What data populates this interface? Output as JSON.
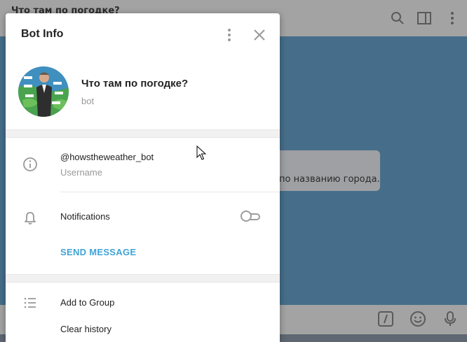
{
  "background": {
    "chat_title": "Что там по погодке?",
    "message_text": "по названию города.",
    "icons": [
      "search-icon",
      "sidebar-toggle-icon",
      "menu-icon",
      "bot-command-icon",
      "emoji-icon",
      "microphone-icon"
    ]
  },
  "modal": {
    "title": "Bot Info",
    "bot_name": "Что там по погодке?",
    "bot_status": "bot",
    "username": "@howstheweather_bot",
    "username_label": "Username",
    "notifications_label": "Notifications",
    "notifications_enabled": false,
    "send_message": "SEND MESSAGE",
    "add_to_group": "Add to Group",
    "clear_history": "Clear history"
  },
  "colors": {
    "accent": "#3ea3d6",
    "icon_gray": "#999999"
  }
}
